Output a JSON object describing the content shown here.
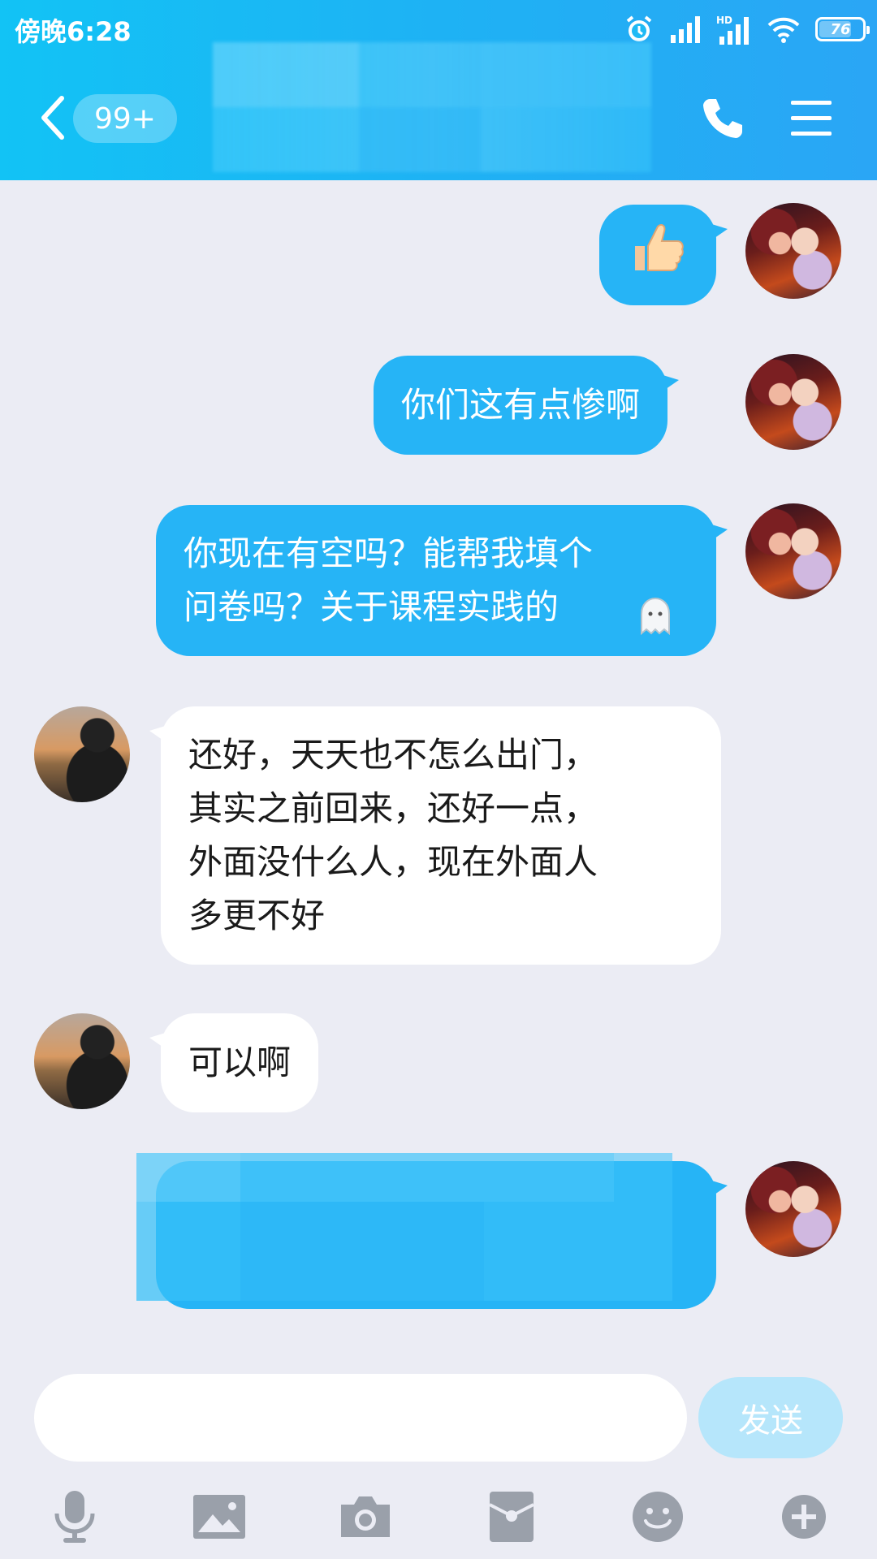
{
  "status_bar": {
    "time": "傍晚6:28",
    "battery": "76"
  },
  "header": {
    "unread_badge": "99+"
  },
  "messages": [
    {
      "direction": "out",
      "type": "emoji",
      "emoji": "👍"
    },
    {
      "direction": "out",
      "type": "text",
      "text": "你们这有点惨啊"
    },
    {
      "direction": "out",
      "type": "text",
      "text": "你现在有空吗？能帮我填个\n问卷吗？关于课程实践的",
      "trailing_icon": "ghost-emoji-icon"
    },
    {
      "direction": "in",
      "type": "text",
      "text": "还好，天天也不怎么出门，\n其实之前回来，还好一点，\n外面没什么人，现在外面人\n多更不好"
    },
    {
      "direction": "in",
      "type": "text",
      "text": "可以啊"
    },
    {
      "direction": "out",
      "type": "redacted"
    }
  ],
  "input": {
    "value": "",
    "send_label": "发送"
  },
  "toolbar": {
    "icons": [
      "microphone-icon",
      "image-icon",
      "camera-icon",
      "red-packet-icon",
      "emoji-icon",
      "plus-icon"
    ]
  },
  "colors": {
    "header_start": "#12c3f5",
    "header_end": "#2aa6f5",
    "outgoing_bubble": "#26b4f6",
    "incoming_bubble": "#ffffff",
    "background": "#ebecf4",
    "send_button": "#b6e6fb",
    "toolbar_icon": "#9aa0aa"
  }
}
